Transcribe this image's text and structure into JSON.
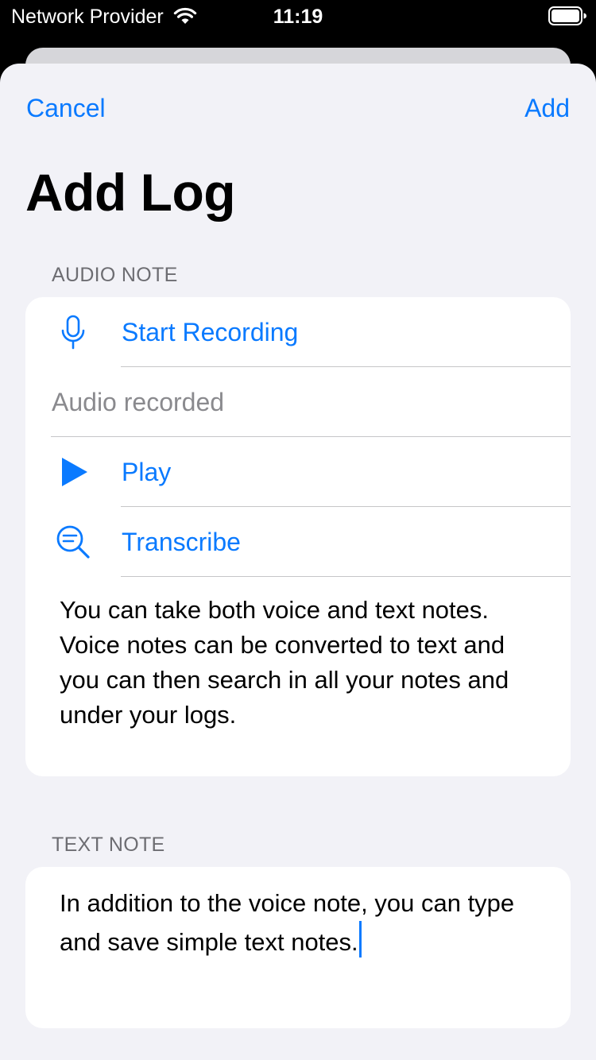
{
  "status_bar": {
    "carrier": "Network Provider",
    "time": "11:19"
  },
  "nav": {
    "cancel_label": "Cancel",
    "add_label": "Add"
  },
  "title": "Add Log",
  "audio_section": {
    "header": "AUDIO NOTE",
    "start_recording_label": "Start Recording",
    "recorded_status": "Audio recorded",
    "play_label": "Play",
    "transcribe_label": "Transcribe",
    "transcript": "You can take both voice and text notes. Voice notes can be converted to text and you can then search in all your notes and under your logs."
  },
  "text_section": {
    "header": "TEXT NOTE",
    "value": "In addition to the voice note, you can type and save simple text notes."
  },
  "colors": {
    "accent": "#0a7aff",
    "sheet_background": "#f2f2f7",
    "secondary_text": "#6d6d72"
  },
  "icons": {
    "wifi": "wifi-icon",
    "battery": "battery-icon",
    "microphone": "microphone-icon",
    "play": "play-icon",
    "transcribe": "transcribe-search-icon"
  }
}
